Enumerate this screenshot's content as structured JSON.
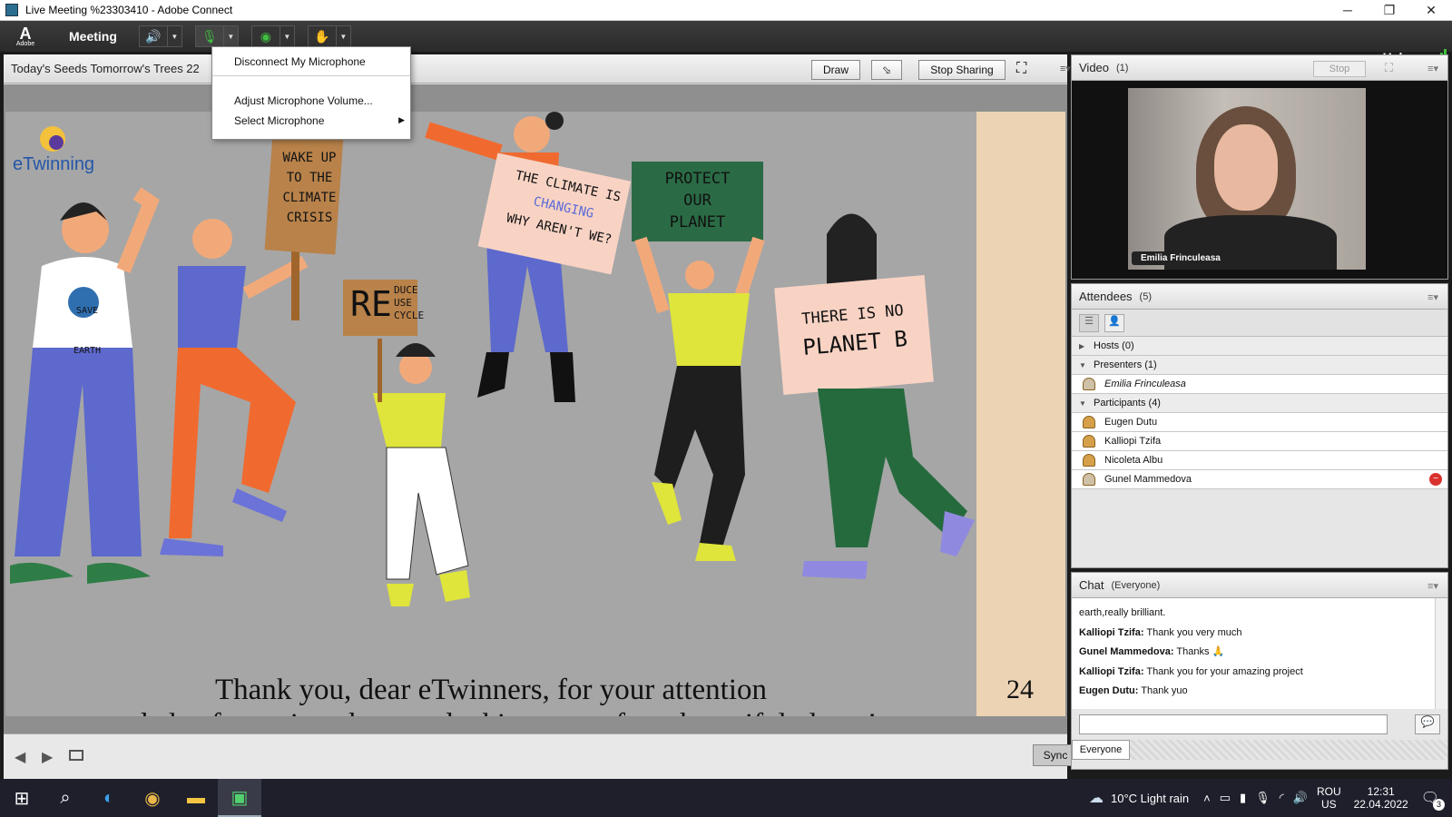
{
  "window": {
    "title": "Live Meeting %23303410 - Adobe Connect",
    "minimize": "─",
    "restore": "❐",
    "close": "✕"
  },
  "menubar": {
    "adobe_logo": "Adobe",
    "meeting_label": "Meeting",
    "help_label": "Help"
  },
  "mic_dropdown": {
    "items": [
      "Disconnect My Microphone",
      "Adjust Microphone Volume...",
      "Select Microphone"
    ]
  },
  "share_pod": {
    "title": "Today's Seeds Tomorrow's Trees 22",
    "draw_label": "Draw",
    "stop_sharing_label": "Stop Sharing",
    "sync_label": "Sync"
  },
  "slide": {
    "logo_text": "eTwinning",
    "sign_wake": [
      "WAKE UP",
      "TO THE",
      "CLIMATE",
      "CRISIS"
    ],
    "sign_climate": [
      "THE CLIMATE IS",
      "CHANGING",
      "WHY AREN'T WE?"
    ],
    "sign_protect": [
      "PROTECT",
      "OUR",
      "PLANET"
    ],
    "sign_planetb": [
      "THERE IS NO",
      "PLANET B"
    ],
    "sign_reduce_big": "RE",
    "sign_reduce": [
      "DUCE",
      "USE",
      "CYCLE"
    ],
    "shirt": [
      "SAVE",
      "EARTH"
    ],
    "thanks_line1": "Thank you, dear eTwinners, for your attention",
    "thanks_line2": "and also for caring about and taking care of our beautiful planet!",
    "page_number": "24"
  },
  "video_pod": {
    "title": "Video",
    "count": "(1)",
    "stop_label": "Stop",
    "person_name": "Emilia Frinculeasa"
  },
  "attendees_pod": {
    "title": "Attendees",
    "count": "(5)",
    "hosts_label": "Hosts (0)",
    "presenters_label": "Presenters (1)",
    "presenters": [
      "Emilia Frinculeasa"
    ],
    "participants_label": "Participants (4)",
    "participants": [
      "Eugen Dutu",
      "Kalliopi Tzifa",
      "Nicoleta Albu",
      "Gunel Mammedova"
    ]
  },
  "chat_pod": {
    "title": "Chat",
    "scope": "(Everyone)",
    "messages": [
      {
        "sender": "",
        "text": "earth,really brilliant."
      },
      {
        "sender": "Kalliopi Tzifa:",
        "text": " Thank you very much"
      },
      {
        "sender": "Gunel Mammedova:",
        "text": " Thanks 🙏"
      },
      {
        "sender": "Kalliopi Tzifa:",
        "text": " Thank you for your amazing project"
      },
      {
        "sender": "Eugen Dutu:",
        "text": " Thank yuo"
      }
    ],
    "input_value": "",
    "audience_tab": "Everyone"
  },
  "taskbar": {
    "weather": "10°C  Light rain",
    "lang_top": "ROU",
    "lang_bottom": "US",
    "time": "12:31",
    "date": "22.04.2022",
    "notif_count": "3"
  },
  "colors": {
    "mic_green": "#3fbf3f",
    "accent_blue": "#1e88e5"
  }
}
